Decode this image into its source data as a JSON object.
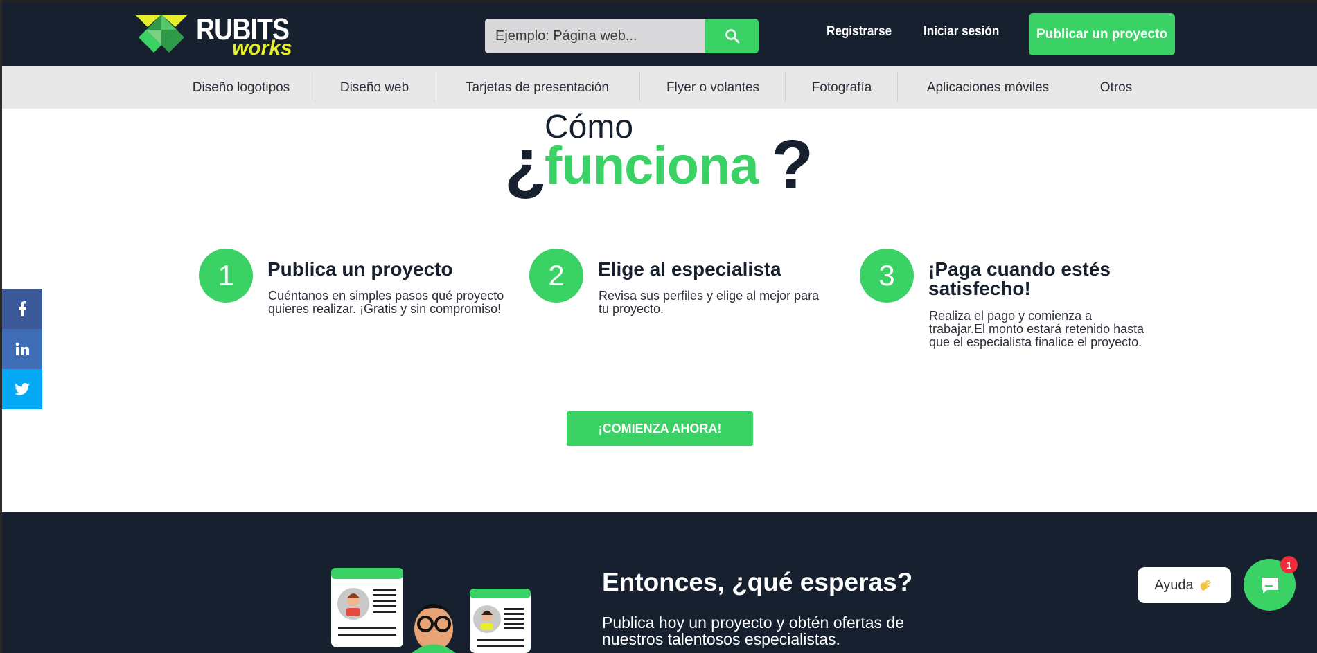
{
  "brand": {
    "name": "RUBITS",
    "sub": "works",
    "colors": {
      "dark": "#16202f",
      "green": "#3ad165",
      "yellow": "#e6ee2c"
    }
  },
  "header": {
    "search_placeholder": "Ejemplo: Página web...",
    "register": "Registrarse",
    "login": "Iniciar sesión",
    "publish": "Publicar un proyecto"
  },
  "categories": [
    "Diseño logotipos",
    "Diseño web",
    "Tarjetas de presentación",
    "Flyer o volantes",
    "Fotografía",
    "Aplicaciones móviles",
    "Otros"
  ],
  "how": {
    "open_q": "¿",
    "como": "Cómo",
    "funciona": "funciona",
    "close_q": "?"
  },
  "steps": [
    {
      "num": "1",
      "title": "Publica un proyecto",
      "text": "Cuéntanos en simples pasos qué proyecto quieres realizar. ¡Gratis y sin compromiso!"
    },
    {
      "num": "2",
      "title": "Elige al especialista",
      "text": "Revisa sus perfiles y elige al mejor para tu proyecto."
    },
    {
      "num": "3",
      "title": "¡Paga cuando estés satisfecho!",
      "text": "Realiza el pago y comienza a trabajar.El monto estará retenido hasta que el especialista finalice el proyecto."
    }
  ],
  "start_button": "¡COMIENZA AHORA!",
  "social": [
    {
      "name": "facebook",
      "color": "#3b5998"
    },
    {
      "name": "linkedin",
      "color": "#3e6db5"
    },
    {
      "name": "twitter",
      "color": "#03a9f4"
    }
  ],
  "band": {
    "title": "Entonces, ¿qué esperas?",
    "text": "Publica hoy un proyecto y obtén ofertas de nuestros talentosos especialistas."
  },
  "help": {
    "label": "Ayuda",
    "badge": "1"
  }
}
